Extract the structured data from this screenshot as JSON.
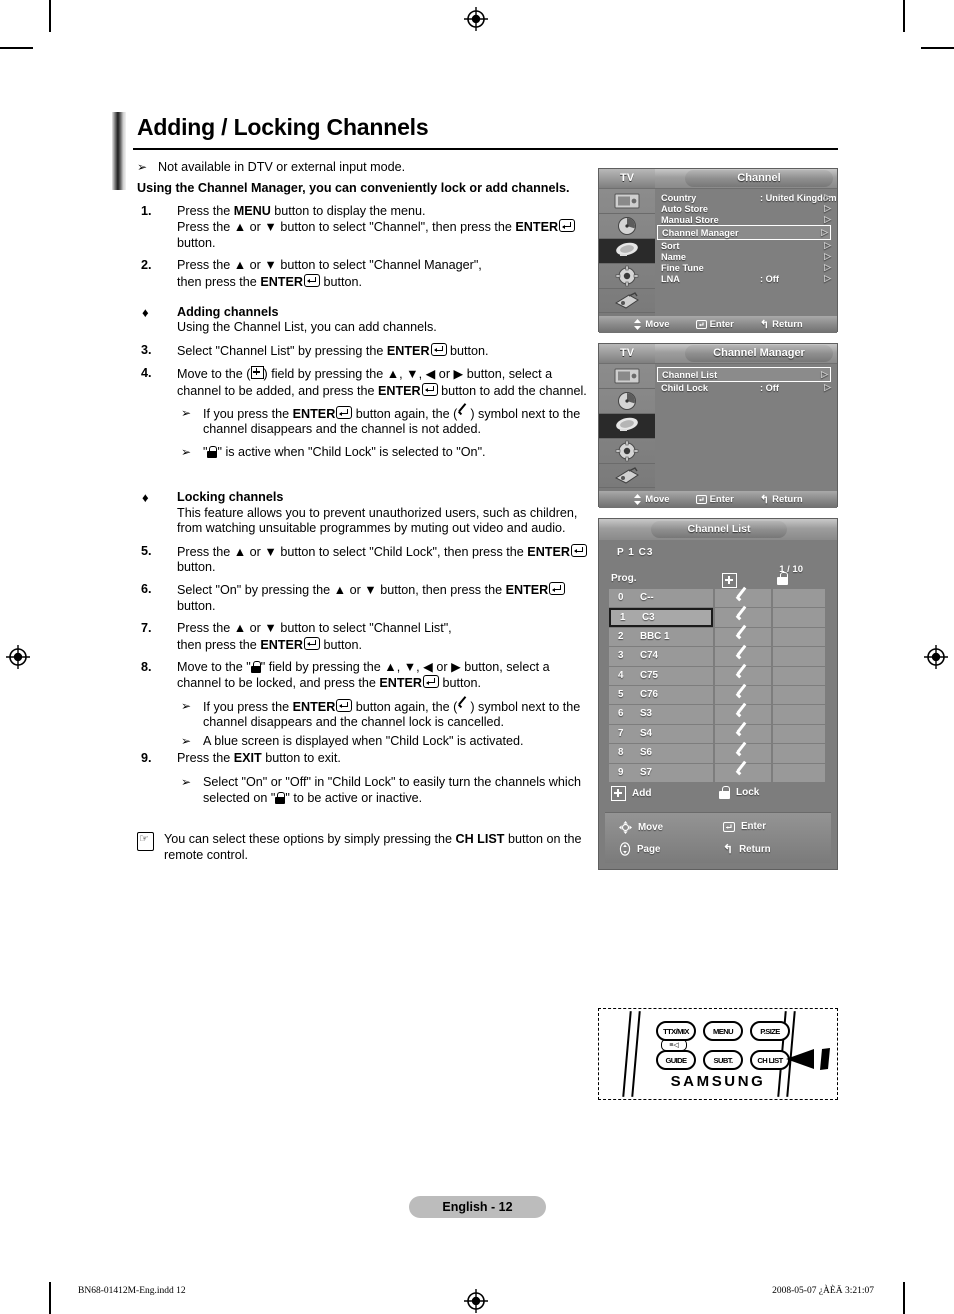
{
  "page": {
    "title": "Adding / Locking Channels",
    "page_label": "English - 12",
    "footer_left": "BN68-01412M-Eng.indd   12",
    "footer_right": "2008-05-07   ¿ÀÈÄ 3:21:07"
  },
  "intro": {
    "note": "Not available in DTV or external input mode.",
    "bold_para": "Using the Channel Manager, you can conveniently lock or add channels."
  },
  "steps": {
    "s1_num": "1.",
    "s1_l1_a": "Press the ",
    "s1_l1_b": "MENU",
    "s1_l1_c": " button to display the menu.",
    "s1_l2_a": "Press the ▲ or ▼ button to select \"Channel\", then press the ",
    "s1_l2_b": "ENTER",
    "s1_l2_c": " button.",
    "s2_num": "2.",
    "s2_a": "Press the ▲ or ▼ button to select \"Channel Manager\",",
    "s2_b": "then press the ",
    "s2_c": "ENTER",
    "s2_d": " button.",
    "s3_num": "3.",
    "s3_a": "Select \"Channel List\" by pressing the ",
    "s3_b": "ENTER",
    "s3_c": " button.",
    "s4_num": "4.",
    "s4_a": "Move to the (",
    "s4_b": ") field by pressing the ▲, ▼, ◀ or ▶ button, select a channel to be added, and press the ",
    "s4_c": "ENTER",
    "s4_d": " button to add the channel.",
    "s5_num": "5.",
    "s5_a": "Press the ▲ or ▼ button to select \"Child Lock\", then press the ",
    "s5_b": "ENTER",
    "s5_c": " button.",
    "s6_num": "6.",
    "s6_a": "Select \"On\" by pressing the ▲ or ▼ button, then press the ",
    "s6_b": "ENTER",
    "s6_c": " button.",
    "s7_num": "7.",
    "s7_a": "Press the ▲ or ▼ button to select \"Channel List\",",
    "s7_b": "then press the ",
    "s7_c": "ENTER",
    "s7_d": " button.",
    "s8_num": "8.",
    "s8_a": "Move to the \"",
    "s8_b": "\" field by pressing the ▲, ▼, ◀ or ▶ button, select a channel to be locked, and press the ",
    "s8_c": "ENTER",
    "s8_d": " button.",
    "s9_num": "9.",
    "s9_a": "Press the ",
    "s9_b": "EXIT",
    "s9_c": " button to exit."
  },
  "bullets": {
    "adding_title": "Adding channels",
    "adding_text": "Using the Channel List, you can add channels.",
    "locking_title": "Locking channels",
    "locking_text": "This feature allows you to prevent unauthorized users, such as children, from watching unsuitable programmes by muting out video and audio."
  },
  "notes": {
    "n1_a": "If you press the ",
    "n1_b": "ENTER",
    "n1_c": " button again, the (",
    "n1_d": ") symbol next to the channel disappears and the channel is not added.",
    "n2_a": "\"",
    "n2_b": "\" is active when \"Child Lock\" is selected to \"On\".",
    "n3_a": "If you press the ",
    "n3_b": "ENTER",
    "n3_c": " button again, the (",
    "n3_d": ") symbol next to the channel disappears and the channel lock is cancelled.",
    "n4": "A blue screen is displayed when \"Child Lock\" is activated.",
    "n5_a": "Select \"On\" or \"Off\" in \"Child Lock\" to easily turn the channels which selected on \"",
    "n5_b": "\" to be active or inactive.",
    "tip_a": "You can select these options by simply pressing the ",
    "tip_b": "CH LIST",
    "tip_c": " button on the remote control."
  },
  "osd_channel": {
    "tv_label": "TV",
    "title": "Channel",
    "rows": [
      {
        "label": "Country",
        "value": ": United Kingdom",
        "arrow": "▷",
        "highlight": false
      },
      {
        "label": "Auto Store",
        "value": "",
        "arrow": "▷",
        "highlight": false
      },
      {
        "label": "Manual Store",
        "value": "",
        "arrow": "▷",
        "highlight": false
      },
      {
        "label": "Channel Manager",
        "value": "",
        "arrow": "▷",
        "highlight": true
      },
      {
        "label": "Sort",
        "value": "",
        "arrow": "▷",
        "highlight": false
      },
      {
        "label": "Name",
        "value": "",
        "arrow": "▷",
        "highlight": false
      },
      {
        "label": "Fine Tune",
        "value": "",
        "arrow": "▷",
        "highlight": false
      },
      {
        "label": "LNA",
        "value": ": Off",
        "arrow": "▷",
        "highlight": false
      }
    ],
    "foot_move": "Move",
    "foot_enter": "Enter",
    "foot_return": "Return"
  },
  "osd_manager": {
    "tv_label": "TV",
    "title": "Channel Manager",
    "rows": [
      {
        "label": "Channel List",
        "value": "",
        "arrow": "▷",
        "highlight": true
      },
      {
        "label": "Child Lock",
        "value": ": Off",
        "arrow": "▷",
        "highlight": false
      }
    ],
    "foot_move": "Move",
    "foot_enter": "Enter",
    "foot_return": "Return"
  },
  "channel_list": {
    "title": "Channel List",
    "current": "P  1   C3",
    "page_indicator": "1 / 10",
    "col_prog": "Prog.",
    "legend_add": "Add",
    "legend_lock": "Lock",
    "scroll_up": "▲",
    "scroll_down": "▼",
    "rows": [
      {
        "num": "0",
        "name": "C--",
        "added": true,
        "locked": false,
        "selected": false
      },
      {
        "num": "1",
        "name": "C3",
        "added": true,
        "locked": false,
        "selected": true
      },
      {
        "num": "2",
        "name": "BBC 1",
        "added": true,
        "locked": false,
        "selected": false
      },
      {
        "num": "3",
        "name": "C74",
        "added": true,
        "locked": false,
        "selected": false
      },
      {
        "num": "4",
        "name": "C75",
        "added": true,
        "locked": false,
        "selected": false
      },
      {
        "num": "5",
        "name": "C76",
        "added": true,
        "locked": false,
        "selected": false
      },
      {
        "num": "6",
        "name": "S3",
        "added": true,
        "locked": false,
        "selected": false
      },
      {
        "num": "7",
        "name": "S4",
        "added": true,
        "locked": false,
        "selected": false
      },
      {
        "num": "8",
        "name": "S6",
        "added": true,
        "locked": false,
        "selected": false
      },
      {
        "num": "9",
        "name": "S7",
        "added": true,
        "locked": false,
        "selected": false
      }
    ],
    "foot_move": "Move",
    "foot_enter": "Enter",
    "foot_page": "Page",
    "foot_return": "Return"
  },
  "remote": {
    "brand": "SAMSUNG",
    "buttons": [
      "TTX/MIX",
      "MENU",
      "P.SIZE",
      "GUIDE",
      "SUBT.",
      "CH LIST"
    ]
  }
}
